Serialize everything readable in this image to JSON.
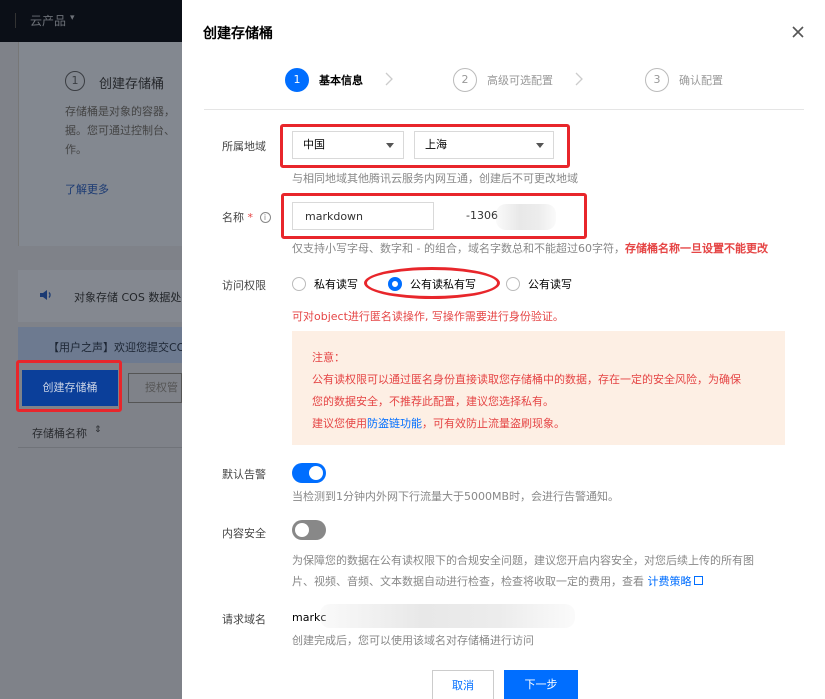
{
  "background": {
    "topbar": {
      "product_menu": "云产品",
      "caret": "▾"
    },
    "guide_card": {
      "step_number": "1",
      "step_title": "创建存储桶",
      "description": "存储桶是对象的容器，\n据。您可通过控制台、\n作。",
      "learn_more": "了解更多"
    },
    "announcement": "对象存储 COS 数据处",
    "user_voice": "【用户之声】欢迎您提交CO",
    "create_bucket_button": "创建存储桶",
    "auth_button": "授权管",
    "table_header_name": "存储桶名称",
    "sort_icon": "⇕"
  },
  "modal": {
    "title": "创建存储桶",
    "steps": [
      {
        "number": "1",
        "label": "基本信息"
      },
      {
        "number": "2",
        "label": "高级可选配置"
      },
      {
        "number": "3",
        "label": "确认配置"
      }
    ],
    "region": {
      "label": "所属地域",
      "country": "中国",
      "city": "上海",
      "hint": "与相同地域其他腾讯云服务内网互通，创建后不可更改地域"
    },
    "name": {
      "label": "名称",
      "required_mark": "*",
      "help_icon": "i",
      "value": "markdown",
      "suffix": "-1306",
      "hint_prefix": "仅支持小写字母、数字和 - 的组合，域名字数总和不能超过60字符，",
      "hint_warning": "存储桶名称一旦设置不能更改"
    },
    "access": {
      "label": "访问权限",
      "options": [
        "私有读写",
        "公有读私有写",
        "公有读写"
      ],
      "selected": "公有读私有写",
      "warning": "可对object进行匿名读操作, 写操作需要进行身份验证。"
    },
    "notice": {
      "title": "注意：",
      "line1": "公有读权限可以通过匿名身份直接读取您存储桶中的数据，存在一定的安全风险，为确保",
      "line2": "您的数据安全，不推荐此配置，建议您选择私有。",
      "line3_prefix": "建议您使用",
      "line3_link": "防盗链功能",
      "line3_suffix": "，可有效防止流量盗刷现象。"
    },
    "alarm": {
      "label": "默认告警",
      "enabled": true,
      "hint": "当检测到1分钟内外网下行流量大于5000MB时，会进行告警通知。"
    },
    "content_security": {
      "label": "内容安全",
      "enabled": false,
      "hint_line1": "为保障您的数据在公有读权限下的合规安全问题，建议您开启内容安全，对您后续上传的所有图",
      "hint_line2_prefix": "片、视频、音频、文本数据自动进行检查，检查将收取一定的费用，查看 ",
      "hint_link": "计费策略"
    },
    "domain": {
      "label": "请求域名",
      "value": "markc",
      "hint": "创建完成后，您可以使用该域名对存储桶进行访问"
    },
    "buttons": {
      "cancel": "取消",
      "next": "下一步"
    }
  },
  "colors": {
    "primary": "#006eff",
    "warning": "#e54545",
    "annotation": "#e8262b"
  }
}
